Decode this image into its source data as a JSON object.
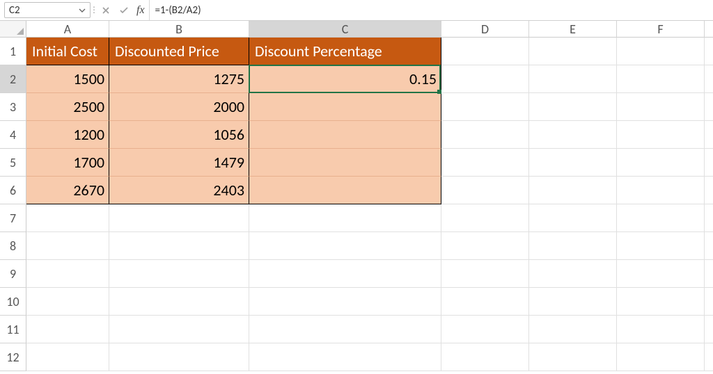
{
  "formula_bar": {
    "cell_ref": "C2",
    "formula": "=1-(B2/A2)",
    "fx_label": "fx"
  },
  "columns": [
    "A",
    "B",
    "C",
    "D",
    "E",
    "F"
  ],
  "selected_column": "C",
  "row_nums": [
    "1",
    "2",
    "3",
    "4",
    "5",
    "6",
    "7",
    "8",
    "9",
    "10",
    "11",
    "12"
  ],
  "selected_row": "2",
  "headers": {
    "A": "Initial Cost",
    "B": "Discounted Price",
    "C": "Discount Percentage"
  },
  "data": {
    "r2": {
      "A": "1500",
      "B": "1275",
      "C": "0.15"
    },
    "r3": {
      "A": "2500",
      "B": "2000",
      "C": ""
    },
    "r4": {
      "A": "1200",
      "B": "1056",
      "C": ""
    },
    "r5": {
      "A": "1700",
      "B": "1479",
      "C": ""
    },
    "r6": {
      "A": "2670",
      "B": "2403",
      "C": ""
    }
  },
  "active_cell": "C2"
}
